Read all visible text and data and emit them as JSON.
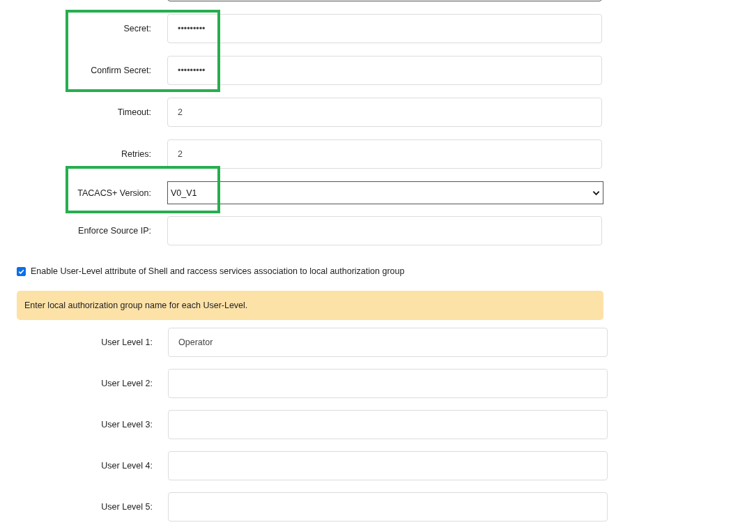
{
  "server_fields": [
    {
      "kind": "partial",
      "highlighted": false
    },
    {
      "kind": "text",
      "label": "Secret:",
      "value": "•••••••••",
      "highlighted": true
    },
    {
      "kind": "text",
      "label": "Confirm Secret:",
      "value": "•••••••••",
      "highlighted": true
    },
    {
      "kind": "text",
      "label": "Timeout:",
      "value": "2",
      "highlighted": false
    },
    {
      "kind": "text",
      "label": "Retries:",
      "value": "2",
      "highlighted": false
    },
    {
      "kind": "select",
      "label": "TACACS+ Version:",
      "value": "V0_V1",
      "highlighted": true
    },
    {
      "kind": "text",
      "label": "Enforce Source IP:",
      "highlighted": false
    }
  ],
  "user_level_option": {
    "label": "Enable User-Level attribute of Shell and raccess services association to local authorization group",
    "checked": true
  },
  "notice": "Enter local authorization group name for each User-Level.",
  "user_levels": [
    {
      "label": "User Level 1:",
      "value": "Operator"
    },
    {
      "label": "User Level 2:"
    },
    {
      "label": "User Level 3:"
    },
    {
      "label": "User Level 4:"
    },
    {
      "label": "User Level 5:"
    }
  ]
}
